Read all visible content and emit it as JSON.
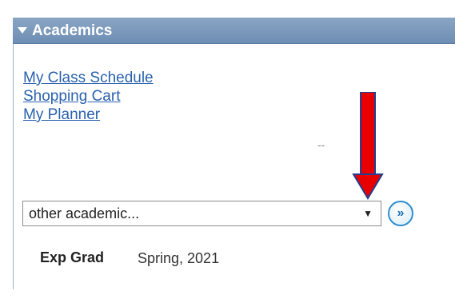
{
  "panel": {
    "title": "Academics"
  },
  "links": [
    "My Class Schedule",
    "Shopping Cart",
    "My Planner"
  ],
  "dash_text": "--",
  "academic_select": {
    "selected": "other academic...",
    "arrow": "▼"
  },
  "go_button": {
    "icon": "double-chevron-right-icon",
    "glyph": "»"
  },
  "exp_grad": {
    "label": "Exp Grad",
    "value": "Spring, 2021"
  },
  "colors": {
    "header": "#7695bb",
    "link": "#2a62ae",
    "annotation_arrow": "#e80000"
  }
}
